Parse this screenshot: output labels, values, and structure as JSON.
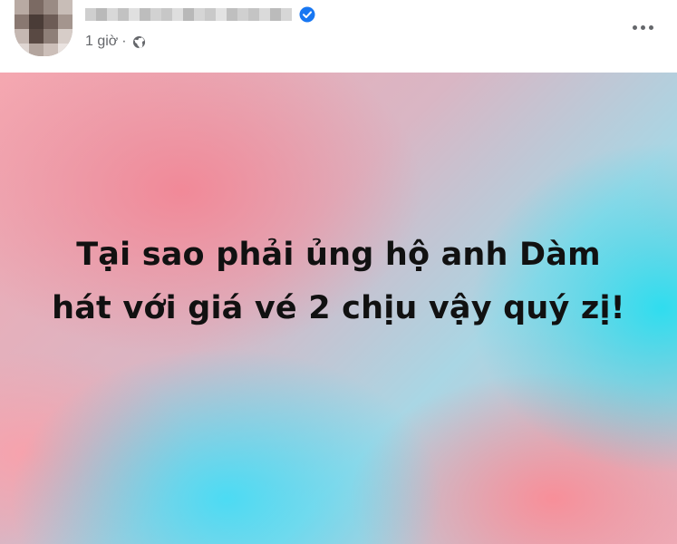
{
  "post": {
    "time_label": "1 giờ",
    "separator": "·",
    "privacy_icon": "globe-icon",
    "verified_icon": "verified-badge-icon",
    "more_icon": "more-options-icon",
    "status_text": "Tại sao phải ủng hộ anh Dàm hát với giá vé 2 chịu vậy quý zị!"
  },
  "colors": {
    "verified_blue": "#1877f2",
    "meta_gray": "#65676b",
    "text_dark": "#111111"
  }
}
